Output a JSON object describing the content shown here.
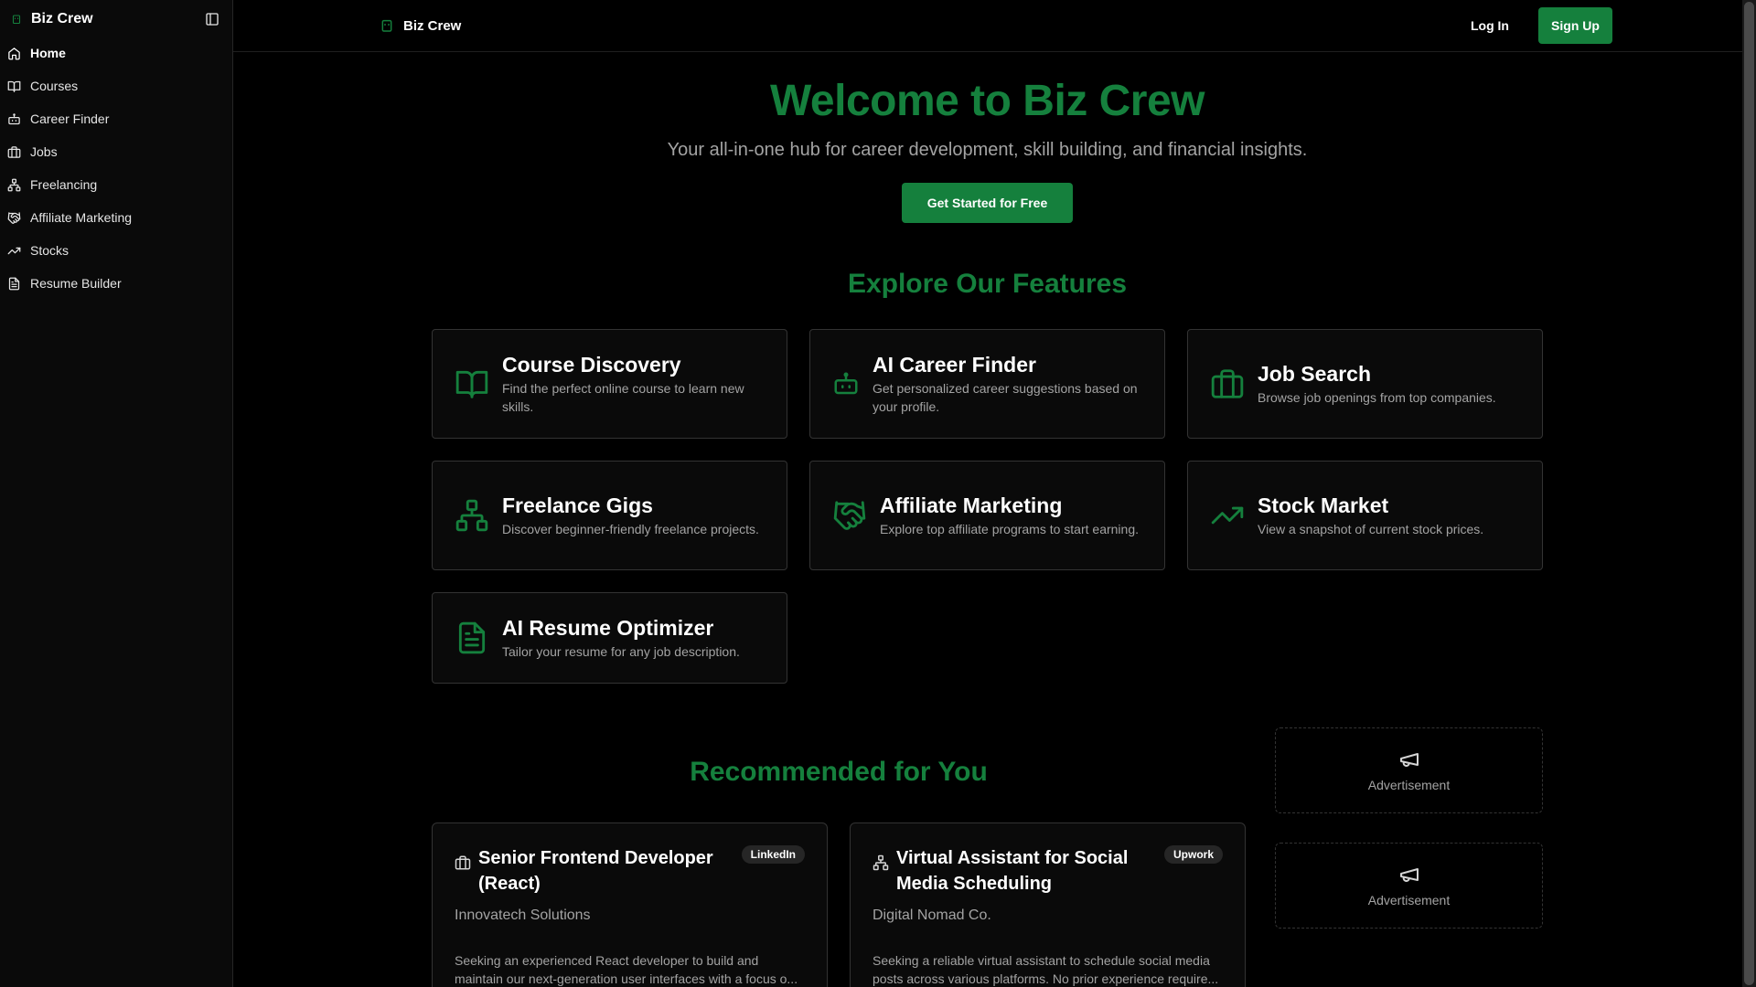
{
  "colors": {
    "accent": "#15803d",
    "background": "#000000",
    "card": "#0a0a0a",
    "muted": "#a3a3a3"
  },
  "sidebar": {
    "brand": "Biz Crew",
    "items": [
      {
        "label": "Home",
        "icon": "home-icon"
      },
      {
        "label": "Courses",
        "icon": "book-open-icon"
      },
      {
        "label": "Career Finder",
        "icon": "bot-icon"
      },
      {
        "label": "Jobs",
        "icon": "briefcase-icon"
      },
      {
        "label": "Freelancing",
        "icon": "network-icon"
      },
      {
        "label": "Affiliate Marketing",
        "icon": "handshake-icon"
      },
      {
        "label": "Stocks",
        "icon": "trending-up-icon"
      },
      {
        "label": "Resume Builder",
        "icon": "file-text-icon"
      }
    ]
  },
  "header": {
    "brand": "Biz Crew",
    "login": "Log In",
    "signup": "Sign Up"
  },
  "hero": {
    "title": "Welcome to Biz Crew",
    "subtitle": "Your all-in-one hub for career development, skill building, and financial insights.",
    "cta": "Get Started for Free"
  },
  "features": {
    "title": "Explore Our Features",
    "items": [
      {
        "title": "Course Discovery",
        "desc": "Find the perfect online course to learn new skills.",
        "icon": "book-open-icon"
      },
      {
        "title": "AI Career Finder",
        "desc": "Get personalized career suggestions based on your profile.",
        "icon": "bot-icon"
      },
      {
        "title": "Job Search",
        "desc": "Browse job openings from top companies.",
        "icon": "briefcase-icon"
      },
      {
        "title": "Freelance Gigs",
        "desc": "Discover beginner-friendly freelance projects.",
        "icon": "network-icon"
      },
      {
        "title": "Affiliate Marketing",
        "desc": "Explore top affiliate programs to start earning.",
        "icon": "handshake-icon"
      },
      {
        "title": "Stock Market",
        "desc": "View a snapshot of current stock prices.",
        "icon": "trending-up-icon"
      },
      {
        "title": "AI Resume Optimizer",
        "desc": "Tailor your resume for any job description.",
        "icon": "file-text-icon"
      }
    ]
  },
  "recommended": {
    "title": "Recommended for You",
    "jobs": [
      {
        "title": "Senior Frontend Developer (React)",
        "source": "LinkedIn",
        "company": "Innovatech Solutions",
        "desc": "Seeking an experienced React developer to build and maintain our next-generation user interfaces with a focus o...",
        "icon": "briefcase-icon"
      },
      {
        "title": "Virtual Assistant for Social Media Scheduling",
        "source": "Upwork",
        "company": "Digital Nomad Co.",
        "desc": "Seeking a reliable virtual assistant to schedule social media posts across various platforms. No prior experience require...",
        "icon": "network-icon"
      }
    ]
  },
  "ads": [
    {
      "label": "Advertisement",
      "icon": "megaphone-icon"
    },
    {
      "label": "Advertisement",
      "icon": "megaphone-icon"
    }
  ]
}
